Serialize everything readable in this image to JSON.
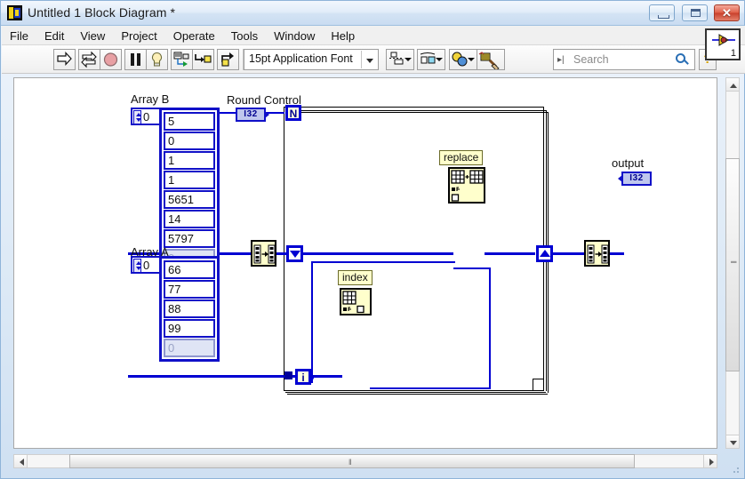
{
  "window": {
    "title": "Untitled 1 Block Diagram *",
    "icon": "labview-vi-icon",
    "buttons": {
      "minimize": "minimize-icon",
      "maximize": "maximize-icon",
      "close": "close-icon",
      "close_glyph": "✕"
    }
  },
  "menubar": {
    "items": [
      "File",
      "Edit",
      "View",
      "Project",
      "Operate",
      "Tools",
      "Window",
      "Help"
    ]
  },
  "toolbar": {
    "run": "run-arrow-icon",
    "run_continuously": "run-continuously-icon",
    "abort": "abort-execution-icon",
    "pause": "pause-icon",
    "highlight_execution": "lightbulb-icon",
    "retain_wire_values": "retain-wire-values-icon",
    "step_into": "step-into-icon",
    "step_over": "step-over-icon",
    "step_out": "step-out-icon",
    "font_label": "15pt Application Font",
    "align_objects": "align-objects-icon",
    "distribute_objects": "distribute-objects-icon",
    "resize_objects": "resize-objects-icon",
    "reorder": "reorder-icon",
    "clean_up_diagram": "clean-up-diagram-icon",
    "search_placeholder": "Search",
    "search_value": "",
    "search_prefix": "▸|",
    "search_icon": "magnifier-icon",
    "help_label": "?",
    "vi_badge_number": "1"
  },
  "diagram": {
    "array_b": {
      "label": "Array B",
      "index_value": "0",
      "cells": [
        "5",
        "0",
        "1",
        "1",
        "5651",
        "14",
        "5797"
      ],
      "empty_cell": "0"
    },
    "array_a": {
      "label": "Array A",
      "index_value": "0",
      "cells": [
        "66",
        "77",
        "88",
        "99"
      ],
      "empty_cell": "0"
    },
    "round_control": {
      "label": "Round Control",
      "terminal": "I32"
    },
    "output": {
      "label": "output",
      "terminal": "I32"
    },
    "for_loop": {
      "count_terminal": "N",
      "iteration_terminal": "i"
    },
    "nodes": [
      {
        "name": "replace-array-subset",
        "label": "replace"
      },
      {
        "name": "index-array",
        "label": "index"
      }
    ],
    "tunnels": {
      "input_indexing": "auto-indexing-input-tunnel",
      "output_indexing": "auto-indexing-output-tunnel"
    }
  },
  "scrollbars": {
    "vertical": "vertical-scrollbar",
    "horizontal": "horizontal-scrollbar",
    "grip": "‖"
  },
  "colors": {
    "wire": "#0000d2",
    "node_fill": "#ffffcc",
    "terminal_fill": "#bfc7ee",
    "accent": "#1010c8"
  }
}
